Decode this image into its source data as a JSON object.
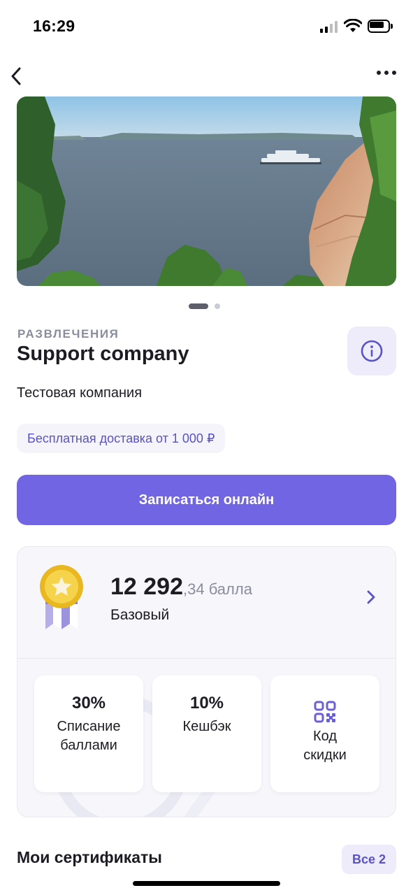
{
  "status_bar": {
    "time": "16:29"
  },
  "company": {
    "category": "РАЗВЛЕЧЕНИЯ",
    "name": "Support company",
    "subtitle": "Тестовая компания",
    "delivery_badge": "Бесплатная доставка от 1 000 ₽"
  },
  "carousel": {
    "total_slides": 2,
    "active_slide": 1
  },
  "cta": {
    "label": "Записаться онлайн"
  },
  "loyalty": {
    "points_integer": "12 292",
    "points_fraction": ",34 балла",
    "level": "Базовый",
    "tiles": [
      {
        "value": "30%",
        "label_line1": "Списание",
        "label_line2": "баллами"
      },
      {
        "value": "10%",
        "label_line1": "Кешбэк",
        "label_line2": ""
      },
      {
        "icon": "qr-code-icon",
        "label_line1": "Код",
        "label_line2": "скидки"
      }
    ]
  },
  "certificates": {
    "title": "Мои сертификаты",
    "all_label": "Все 2"
  },
  "colors": {
    "accent": "#7265e3",
    "accent_text": "#5a52c7",
    "accent_soft": "#eeecfa",
    "muted": "#8a8d9c"
  }
}
